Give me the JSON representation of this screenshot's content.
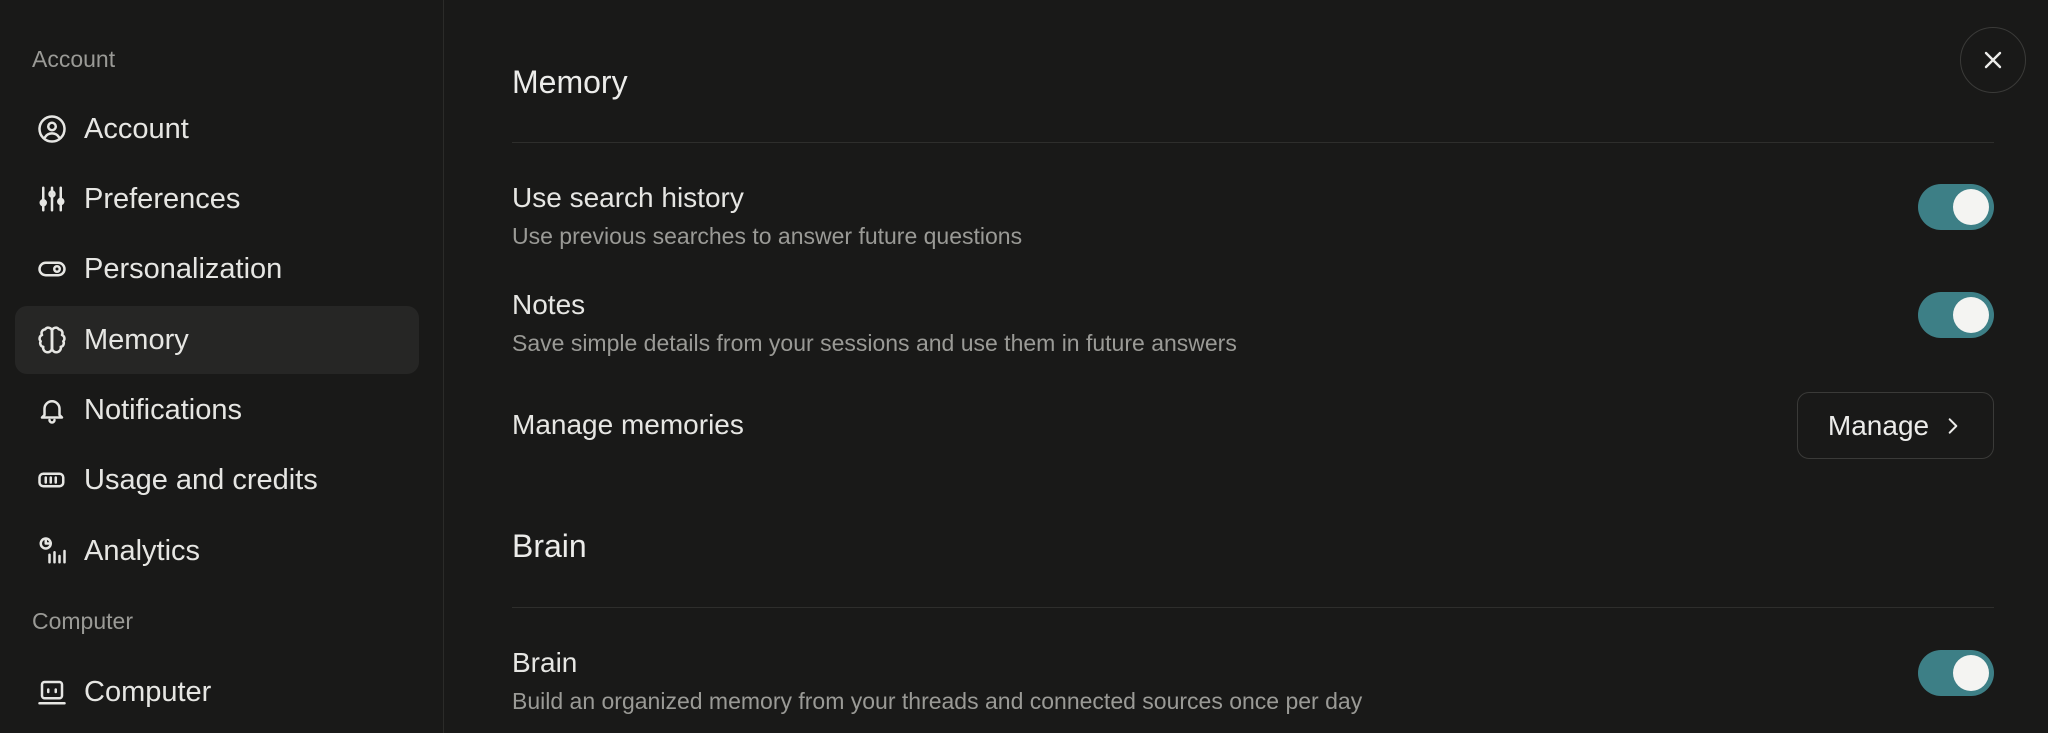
{
  "sidebar": {
    "groups": [
      {
        "label": "Account"
      },
      {
        "label": "Computer"
      }
    ],
    "items": [
      {
        "label": "Account",
        "icon": "user-circle-icon"
      },
      {
        "label": "Preferences",
        "icon": "sliders-icon"
      },
      {
        "label": "Personalization",
        "icon": "toggle-icon"
      },
      {
        "label": "Memory",
        "icon": "brain-icon",
        "active": true
      },
      {
        "label": "Notifications",
        "icon": "bell-icon"
      },
      {
        "label": "Usage and credits",
        "icon": "battery-icon"
      },
      {
        "label": "Analytics",
        "icon": "analytics-icon"
      },
      {
        "label": "Computer",
        "icon": "computer-icon"
      }
    ]
  },
  "main": {
    "memory_section": {
      "title": "Memory",
      "rows": [
        {
          "title": "Use search history",
          "description": "Use previous searches to answer future questions",
          "enabled": true
        },
        {
          "title": "Notes",
          "description": "Save simple details from your sessions and use them in future answers",
          "enabled": true
        },
        {
          "title": "Manage memories",
          "button_label": "Manage"
        }
      ]
    },
    "brain_section": {
      "title": "Brain",
      "rows": [
        {
          "title": "Brain",
          "description": "Build an organized memory from your threads and connected sources once per day",
          "enabled": true
        }
      ]
    }
  },
  "colors": {
    "background": "#191918",
    "toggle_on": "#3d7f86",
    "active_item": "#262625"
  }
}
